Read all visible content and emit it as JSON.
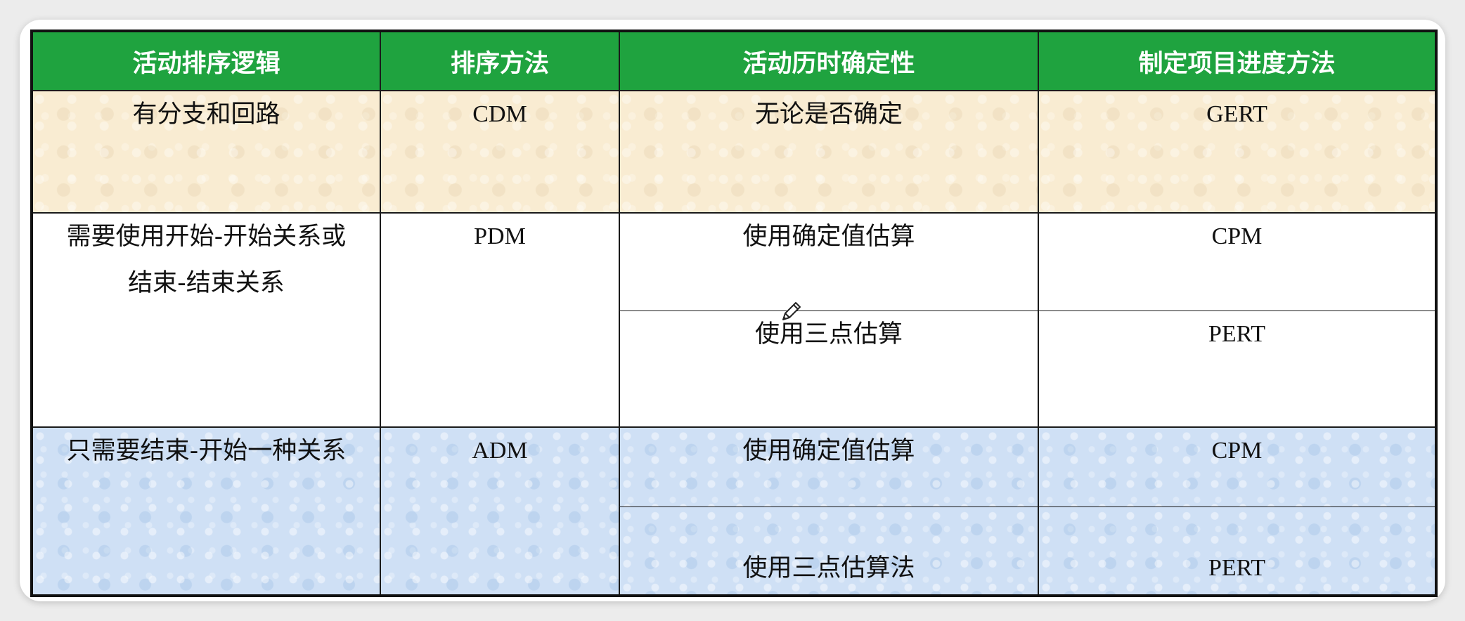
{
  "headers": [
    "活动排序逻辑",
    "排序方法",
    "活动历时确定性",
    "制定项目进度方法"
  ],
  "rows": {
    "gert": {
      "logic": "有分支和回路",
      "method": "CDM",
      "certainty": "无论是否确定",
      "schedule": "GERT"
    },
    "pdm": {
      "logic": "需要使用开始-开始关系或结束-结束关系",
      "method": "PDM",
      "certainty_a": "使用确定值估算",
      "schedule_a": "CPM",
      "certainty_b": "使用三点估算",
      "schedule_b": "PERT"
    },
    "adm": {
      "logic": "只需要结束-开始一种关系",
      "method": "ADM",
      "certainty_a": "使用确定值估算",
      "schedule_a": "CPM",
      "certainty_b": "使用三点估算法",
      "schedule_b": "PERT"
    }
  },
  "colors": {
    "header_bg": "#1fa33f",
    "row1_bg": "#f9ecd2",
    "row3_bg": "#cfe0f5"
  },
  "icons": {
    "cursor": "pencil-cursor-icon"
  }
}
